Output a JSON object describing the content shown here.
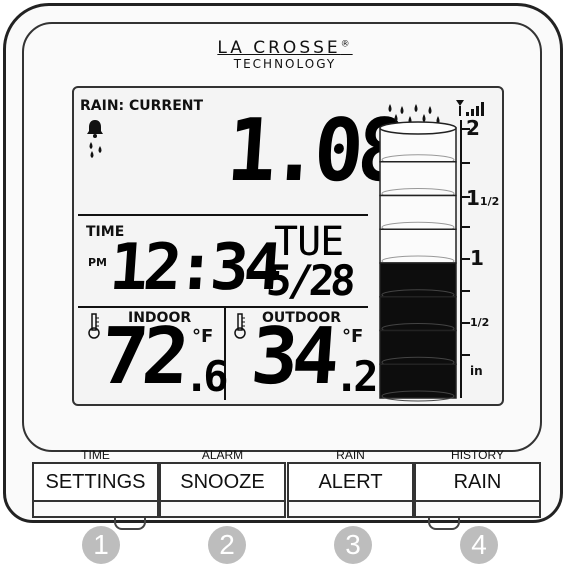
{
  "brand": {
    "name": "LA CROSSE",
    "reg": "®",
    "sub": "TECHNOLOGY"
  },
  "rain": {
    "label": "RAIN: CURRENT",
    "value": "1.08",
    "gauge_fill_fraction": 0.5,
    "scale": {
      "two": "2",
      "one_half_int": "1",
      "one_half_frac": "1/2",
      "one": "1",
      "half": "1/2",
      "unit": "in"
    }
  },
  "time": {
    "label": "TIME",
    "ampm": "PM",
    "value": "12:34",
    "day": "TUE",
    "date": "5/28"
  },
  "indoor": {
    "label": "INDOOR",
    "int": "72",
    "dec": ".6",
    "unit": "°F"
  },
  "outdoor": {
    "label": "OUTDOOR",
    "int": "34",
    "dec": ".2",
    "unit": "°F"
  },
  "buttons": [
    {
      "top": "TIME",
      "label": "SETTINGS",
      "num": "1"
    },
    {
      "top": "ALARM",
      "label": "SNOOZE",
      "num": "2"
    },
    {
      "top": "RAIN",
      "label": "ALERT",
      "num": "3"
    },
    {
      "top": "HISTORY",
      "label": "RAIN",
      "num": "4"
    }
  ],
  "icons": [
    "bell-icon",
    "rain-drops-icon",
    "thermometer-icon",
    "signal-icon",
    "rain-cloud-icon"
  ]
}
